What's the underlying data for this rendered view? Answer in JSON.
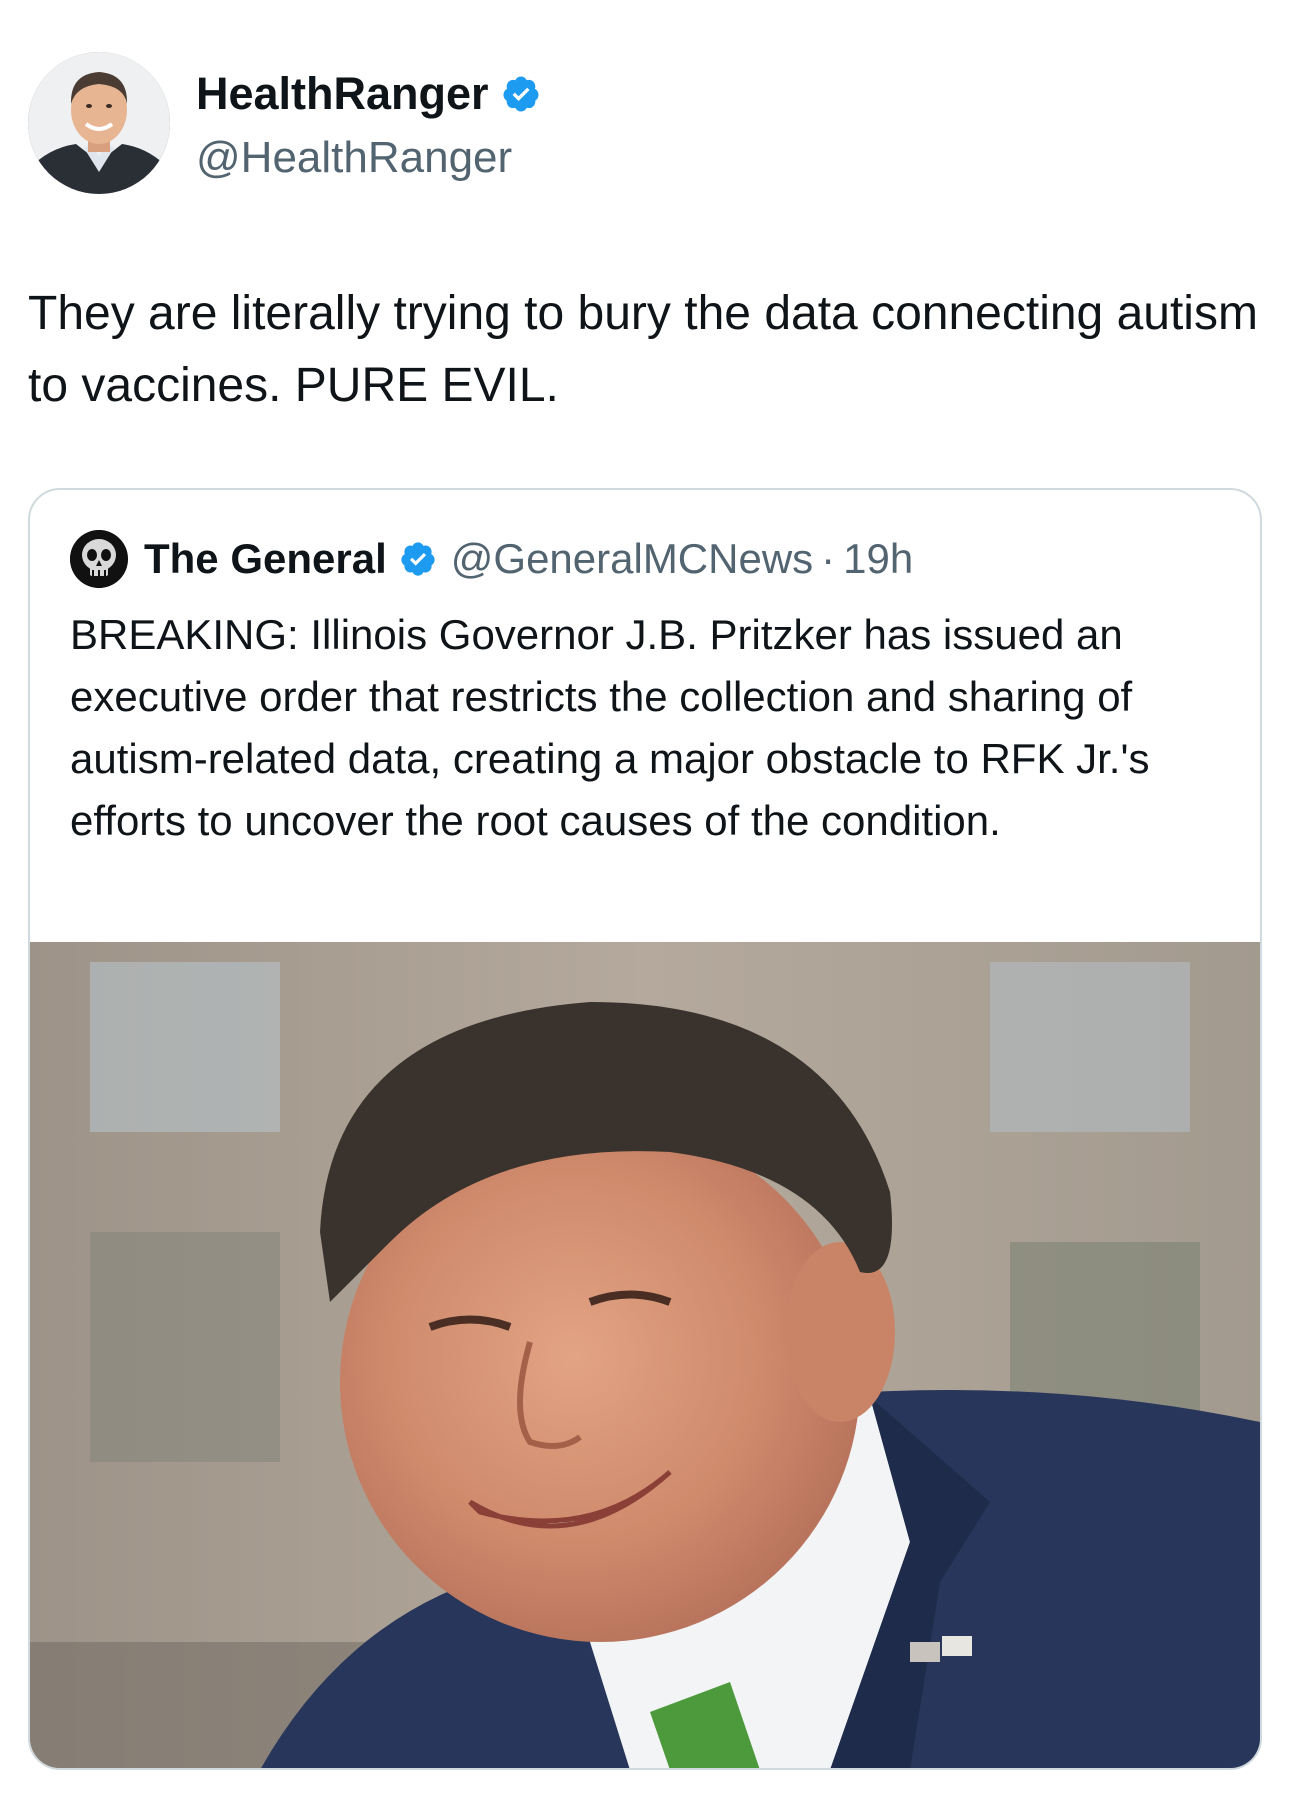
{
  "author": {
    "name": "HealthRanger",
    "handle": "@HealthRanger",
    "verified_icon": "verified-badge-icon",
    "verified_color": "#1d9bf0"
  },
  "tweet": {
    "text": "They are literally trying to bury the data connecting autism to vaccines. PURE EVIL."
  },
  "quoted_tweet": {
    "author_name": "The General",
    "handle": "@GeneralMCNews",
    "separator": "·",
    "time": "19h",
    "text": "BREAKING: Illinois Governor J.B. Pritzker has issued an executive order that restricts the collection and sharing of autism-related data, creating a major obstacle to RFK Jr.'s efforts to uncover the root causes of the condition.",
    "avatar_icon": "skull-emblem-icon",
    "photo": "smiling man in suit and green tie"
  },
  "colors": {
    "text_primary": "#0f1419",
    "text_secondary": "#536471",
    "border": "#cfd9de",
    "accent": "#1d9bf0"
  }
}
